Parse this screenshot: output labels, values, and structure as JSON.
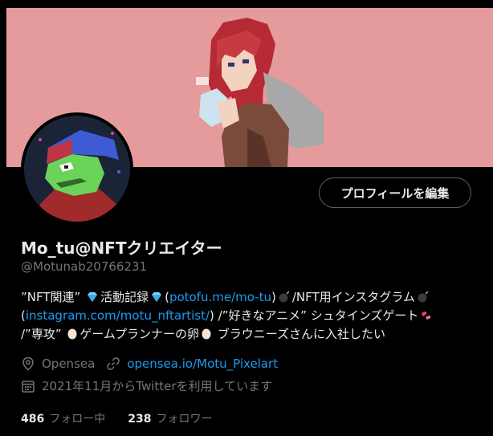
{
  "profile": {
    "edit_button_label": "プロフィールを編集",
    "display_name": "Mo_tu@NFTクリエイター",
    "handle": "@Motunab20766231",
    "bio": {
      "line1_a": "”NFT関連” ",
      "line1_b": "活動記録",
      "line1_c": "(",
      "line1_link": "potofu.me/mo-tu",
      "line1_d": ")",
      "line1_e": "/NFT用インスタグラム",
      "line2_a": "(",
      "line2_link": "instagram.com/motu_nftartist/",
      "line2_b": ") /”好きなアニメ” シュタインズゲート",
      "line3_a": "/”専攻” ",
      "line3_b": "ゲームプランナーの卵",
      "line3_c": " ブラウニーズさんに入社したい"
    },
    "location": "Opensea",
    "website": "opensea.io/Motu_Pixelart",
    "joined": "2021年11月からTwitterを利用しています",
    "following_count": "486",
    "following_label": "フォロー中",
    "followers_count": "238",
    "followers_label": "フォロワー"
  },
  "colors": {
    "banner_bg": "#e59b9b",
    "link": "#1d9bf0",
    "muted": "#71767b",
    "text": "#e7e9ea"
  }
}
